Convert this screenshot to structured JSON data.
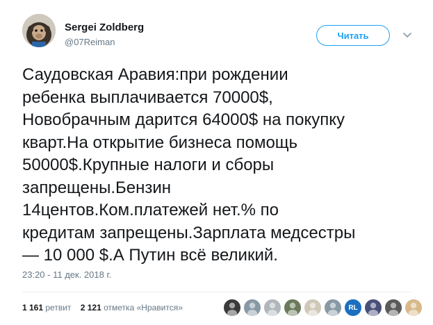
{
  "tweet": {
    "author_name": "Sergei Zoldberg",
    "author_handle": "@07Reiman",
    "follow_label": "Читать",
    "text_lines": [
      "Саудовская Аравия:при рождении",
      "ребенка выплачивается 70000$,",
      "Новобрачным дарится 64000$ на покупку",
      "кварт.На открытие бизнеса помощь",
      "50000$.Крупные налоги и сборы",
      "запрещены.Бензин",
      "14центов.Ком.платежей нет.% по",
      "кредитам запрещены.Зарплата медсестры",
      "— 10 000 $.А Путин всё великий."
    ],
    "timestamp": "23:20 - 11 дек. 2018 г.",
    "retweets_count": "1 161",
    "retweets_label": "ретвит",
    "likes_count": "2 121",
    "likes_label": "отметка «Нравится»",
    "liker_avatars": [
      {
        "icon": "user-avatar",
        "color": "#3a3a3a"
      },
      {
        "icon": "user-avatar",
        "color": "#8899a6"
      },
      {
        "icon": "user-avatar",
        "color": "#b0b6bb"
      },
      {
        "icon": "user-avatar",
        "color": "#6b7a5a"
      },
      {
        "icon": "user-avatar",
        "color": "#cfc7b8"
      },
      {
        "icon": "user-avatar",
        "color": "#8899a6"
      },
      {
        "icon": "user-avatar",
        "label": "RL",
        "color": "#1b6fc0"
      },
      {
        "icon": "user-avatar",
        "color": "#4a4f7a"
      },
      {
        "icon": "user-avatar",
        "color": "#5a5a5a"
      },
      {
        "icon": "user-avatar",
        "color": "#d8b98a"
      }
    ]
  },
  "colors": {
    "accent": "#1da1f2",
    "text": "#14171a",
    "muted": "#657786",
    "divider": "#e6ecf0"
  }
}
